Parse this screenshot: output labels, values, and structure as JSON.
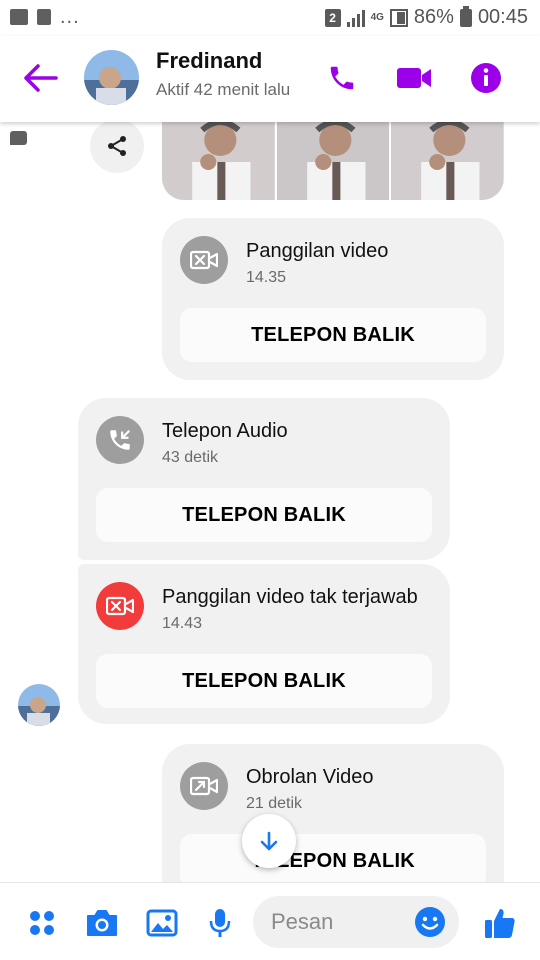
{
  "status_bar": {
    "sim_slot": "2",
    "network": "4G",
    "battery": "86%",
    "time": "00:45",
    "overflow": "..."
  },
  "header": {
    "name": "Fredinand",
    "status": "Aktif 42 menit lalu",
    "accent_color": "#9b00e8"
  },
  "messages": [
    {
      "title": "Panggilan video",
      "sub": "14.35",
      "button": "TELEPON BALIK"
    },
    {
      "title": "Telepon Audio",
      "sub": "43 detik",
      "button": "TELEPON BALIK"
    },
    {
      "title": "Panggilan video tak terjawab",
      "sub": "14.43",
      "button": "TELEPON BALIK",
      "status_color": "#f23b3b"
    },
    {
      "title": "Obrolan Video",
      "sub": "21 detik",
      "button": "TELEPON BALIK"
    }
  ],
  "composer": {
    "placeholder": "Pesan",
    "accent_color": "#1877f2"
  }
}
